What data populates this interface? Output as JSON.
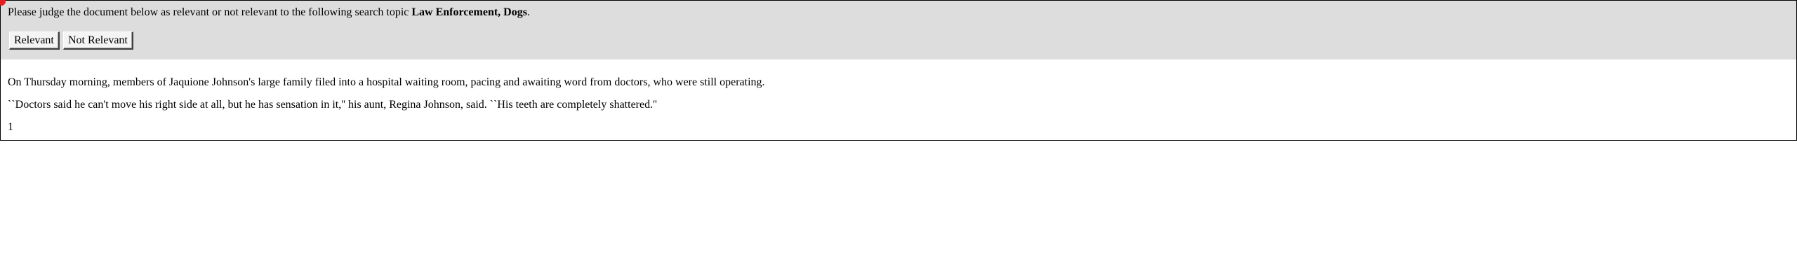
{
  "judgment_panel": {
    "instruction_prefix": "Please judge the document below as relevant or not relevant to the following search topic ",
    "topic": "Law Enforcement, Dogs",
    "instruction_suffix": ".",
    "relevant_label": "Relevant",
    "not_relevant_label": "Not Relevant"
  },
  "document": {
    "paragraphs": [
      "On Thursday morning, members of Jaquione Johnson's large family filed into a hospital waiting room, pacing and awaiting word from doctors, who were still operating.",
      "``Doctors said he can't move his right side at all, but he has sensation in it,'' his aunt, Regina Johnson, said. ``His teeth are completely shattered.''",
      "1"
    ]
  },
  "colors": {
    "header_background": "#dddddd",
    "cursor_marker": "#e02020"
  }
}
